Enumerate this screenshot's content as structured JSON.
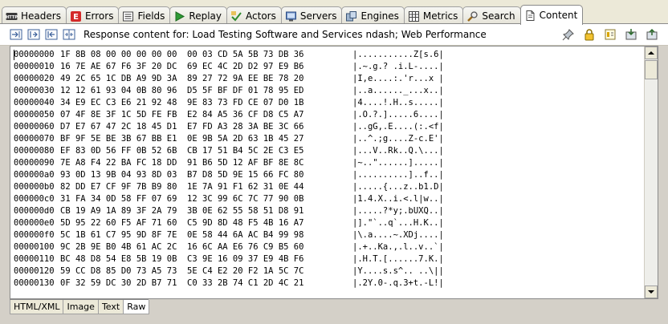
{
  "tabs": [
    {
      "label": "Headers",
      "icon": "http-icon"
    },
    {
      "label": "Errors",
      "icon": "error-icon"
    },
    {
      "label": "Fields",
      "icon": "fields-icon"
    },
    {
      "label": "Replay",
      "icon": "replay-icon"
    },
    {
      "label": "Actors",
      "icon": "actors-icon"
    },
    {
      "label": "Servers",
      "icon": "servers-icon"
    },
    {
      "label": "Engines",
      "icon": "engines-icon"
    },
    {
      "label": "Metrics",
      "icon": "metrics-icon"
    },
    {
      "label": "Search",
      "icon": "search-icon"
    },
    {
      "label": "Content",
      "icon": "content-icon",
      "active": true
    }
  ],
  "http_badge": "HTTP",
  "error_badge": "E",
  "toolbar": {
    "description": "Response content for: Load Testing Software and Services ndash; Web Performance"
  },
  "hex_rows": [
    {
      "offset": "00000000",
      "bytes": "1F 8B 08 00 00 00 00 00  00 03 CD 5A 5B 73 DB 36",
      "ascii": "|...........Z[s.6|"
    },
    {
      "offset": "00000010",
      "bytes": "16 7E AE 67 F6 3F 20 DC  69 EC 4C 2D D2 97 E9 B6",
      "ascii": "|.~.g.? .i.L-....|"
    },
    {
      "offset": "00000020",
      "bytes": "49 2C 65 1C DB A9 9D 3A  89 27 72 9A EE BE 78 20",
      "ascii": "|I,e....:.'r...x |"
    },
    {
      "offset": "00000030",
      "bytes": "12 12 61 93 04 0B 80 96  D5 5F BF DF 01 78 95 ED",
      "ascii": "|..a......_...x..|"
    },
    {
      "offset": "00000040",
      "bytes": "34 E9 EC C3 E6 21 92 48  9E 83 73 FD CE 07 D0 1B",
      "ascii": "|4....!.H..s.....|"
    },
    {
      "offset": "00000050",
      "bytes": "07 4F 8E 3F 1C 5D FE FB  E2 84 A5 36 CF D8 C5 A7",
      "ascii": "|.O.?.].....6....|"
    },
    {
      "offset": "00000060",
      "bytes": "D7 E7 67 47 2C 18 45 D1  E7 FD A3 28 3A BE 3C 66",
      "ascii": "|..gG,.E....(:.<f|"
    },
    {
      "offset": "00000070",
      "bytes": "BF 9F 5E BE 3B 67 BB E1  0E 9B 5A 2D 63 1B 45 27",
      "ascii": "|..^.;g....Z-c.E'|"
    },
    {
      "offset": "00000080",
      "bytes": "EF 83 0D 56 FF 0B 52 6B  CB 17 51 B4 5C 2E C3 E5",
      "ascii": "|...V..Rk..Q.\\...|"
    },
    {
      "offset": "00000090",
      "bytes": "7E A8 F4 22 BA FC 18 DD  91 B6 5D 12 AF BF 8E 8C",
      "ascii": "|~..\"......].....|"
    },
    {
      "offset": "000000a0",
      "bytes": "93 0D 13 9B 04 93 8D 03  B7 D8 5D 9E 15 66 FC 80",
      "ascii": "|..........]..f..|"
    },
    {
      "offset": "000000b0",
      "bytes": "82 DD E7 CF 9F 7B B9 80  1E 7A 91 F1 62 31 0E 44",
      "ascii": "|.....{...z..b1.D|"
    },
    {
      "offset": "000000c0",
      "bytes": "31 FA 34 0D 58 FF 07 69  12 3C 99 6C 7C 77 90 0B",
      "ascii": "|1.4.X..i.<.l|w..|"
    },
    {
      "offset": "000000d0",
      "bytes": "CB 19 A9 1A 89 3F 2A 79  3B 0E 62 55 58 51 D8 91",
      "ascii": "|.....?*y;.bUXQ..|"
    },
    {
      "offset": "000000e0",
      "bytes": "5D 95 22 60 F5 AF 71 60  C5 9D 8D 48 F5 4B 16 A7",
      "ascii": "|].\"`..q`...H.K..|"
    },
    {
      "offset": "000000f0",
      "bytes": "5C 1B 61 C7 95 9D 8F 7E  0E 58 44 6A AC B4 99 98",
      "ascii": "|\\.a....~.XDj....|"
    },
    {
      "offset": "00000100",
      "bytes": "9C 2B 9E B0 4B 61 AC 2C  16 6C AA E6 76 C9 B5 60",
      "ascii": "|.+..Ka.,.l..v..`|"
    },
    {
      "offset": "00000110",
      "bytes": "BC 48 D8 54 E8 5B 19 0B  C3 9E 16 09 37 E9 4B F6",
      "ascii": "|.H.T.[......7.K.|"
    },
    {
      "offset": "00000120",
      "bytes": "59 CC D8 85 D0 73 A5 73  5E C4 E2 20 F2 1A 5C 7C",
      "ascii": "|Y....s.s^.. ..\\||"
    },
    {
      "offset": "00000130",
      "bytes": "0F 32 59 DC 30 2D B7 71  C0 33 2B 74 C1 2D 4C 21",
      "ascii": "|.2Y.0-.q.3+t.-L!|"
    }
  ],
  "bottom_tabs": [
    {
      "label": "HTML/XML"
    },
    {
      "label": "Image"
    },
    {
      "label": "Text"
    },
    {
      "label": "Raw",
      "active": true
    }
  ]
}
